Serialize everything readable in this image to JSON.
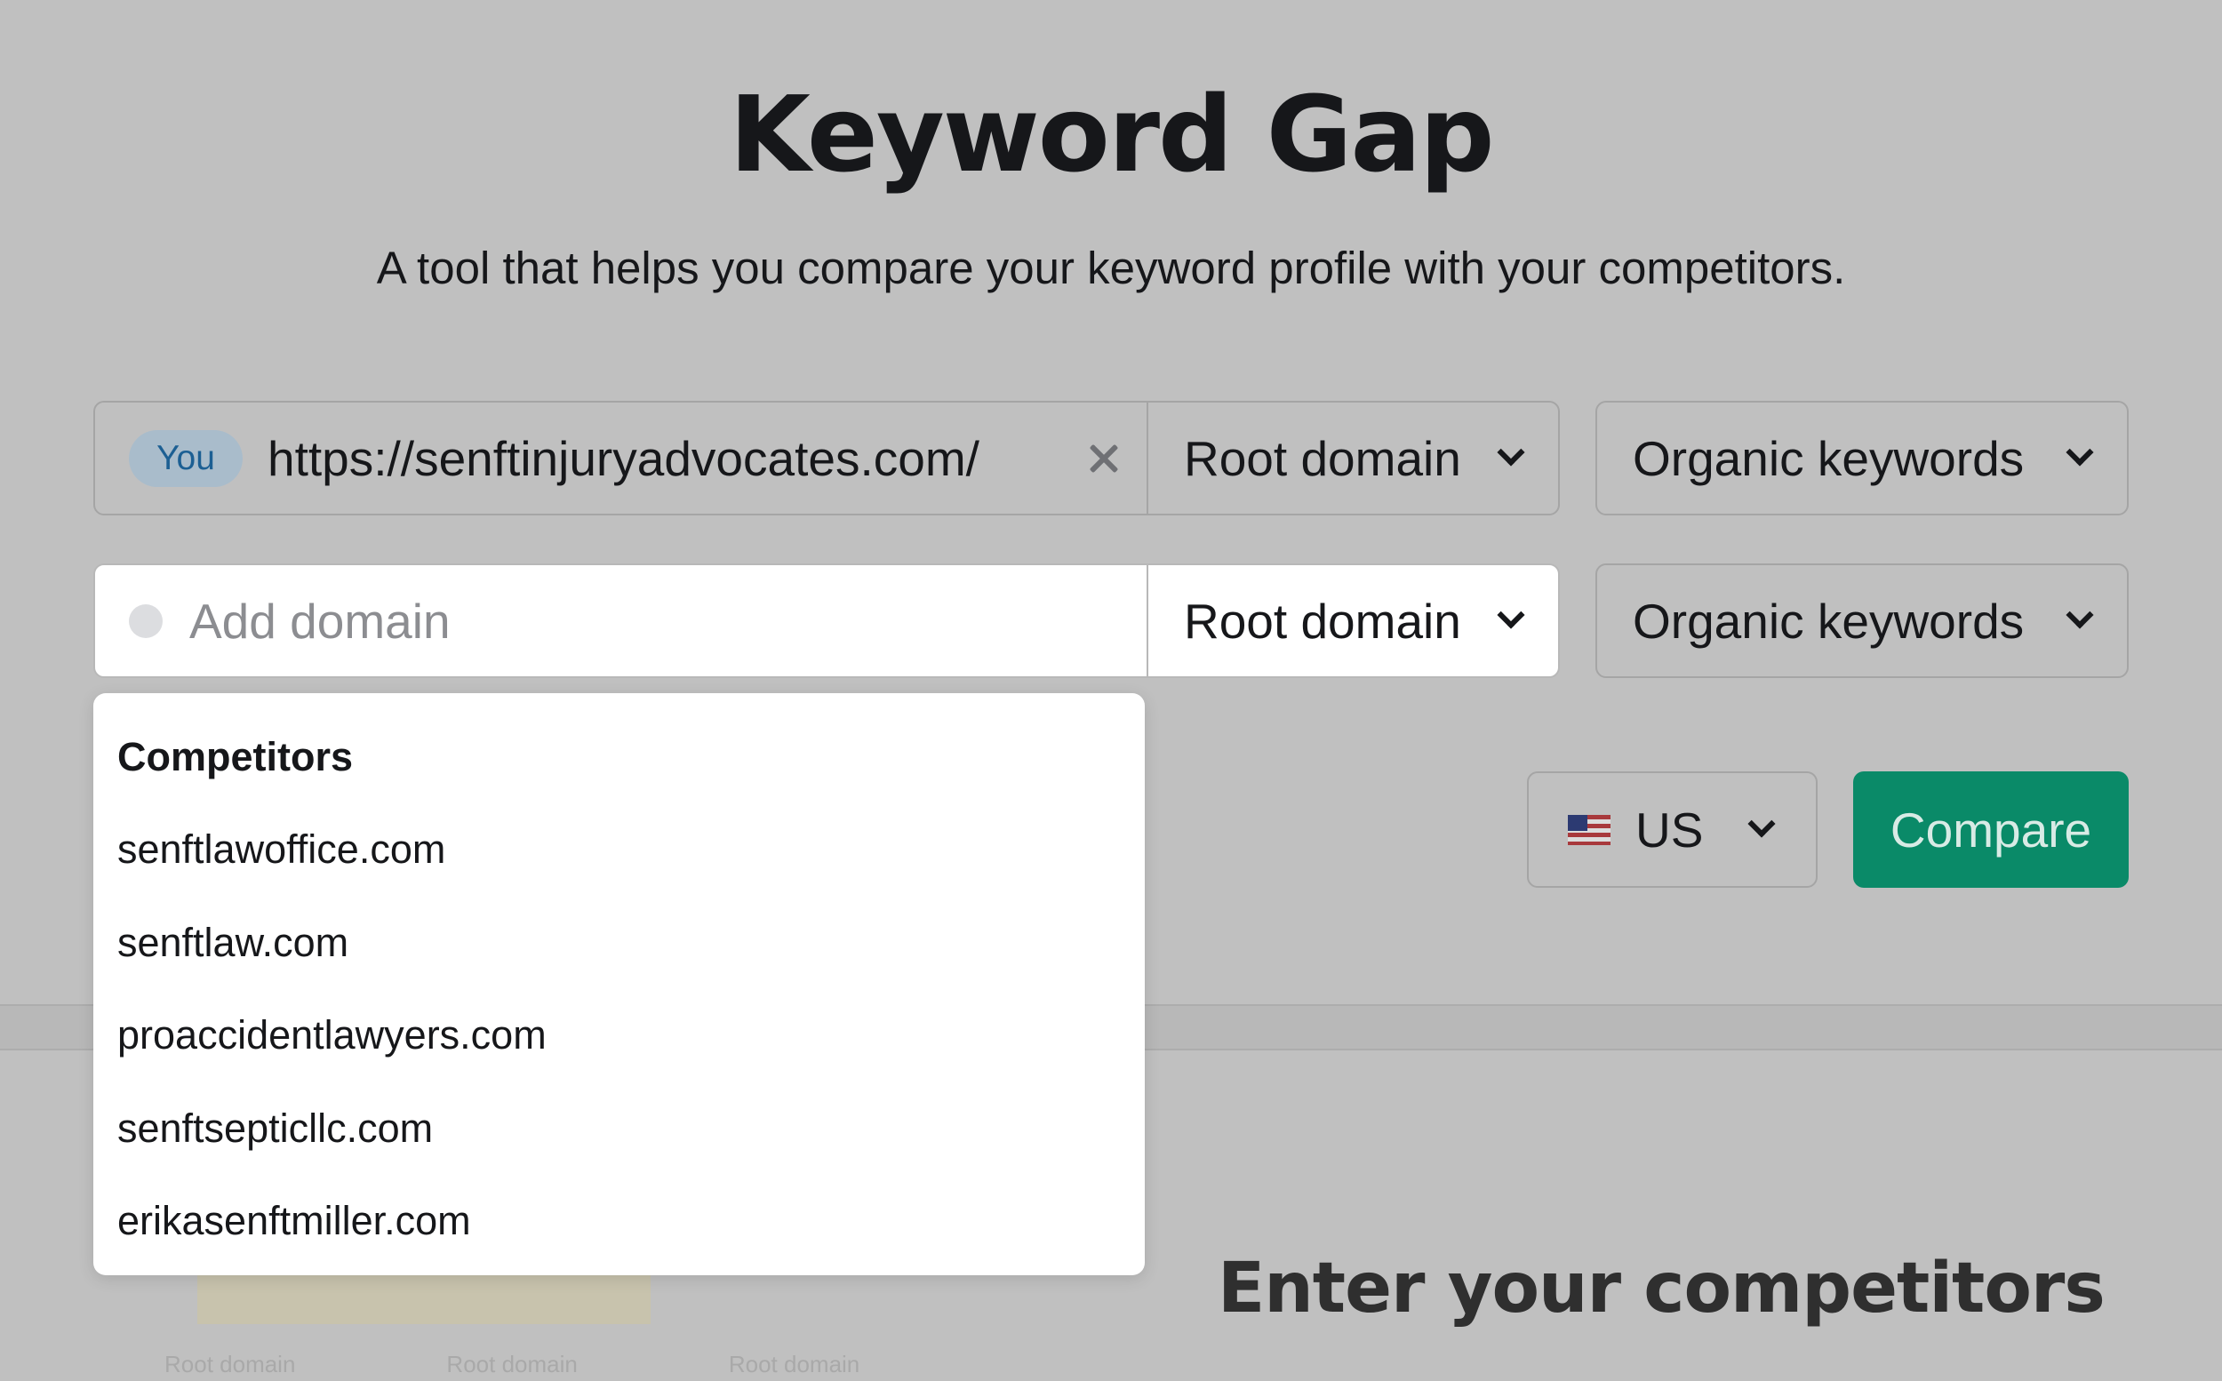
{
  "header": {
    "title": "Keyword Gap",
    "subtitle": "A tool that helps you compare your keyword profile with your competitors."
  },
  "rows": {
    "you": {
      "badge": "You",
      "domain": "https://senftinjuryadvocates.com/",
      "scope": "Root domain",
      "keyword_type": "Organic keywords"
    },
    "add": {
      "placeholder": "Add domain",
      "scope": "Root domain",
      "keyword_type": "Organic keywords"
    }
  },
  "database": {
    "selected": "US",
    "flag_icon": "us-flag-icon"
  },
  "compare_button": "Compare",
  "competitors": {
    "heading": "Competitors",
    "items": [
      "senftlawoffice.com",
      "senftlaw.com",
      "proaccidentlawyers.com",
      "senftsepticllc.com",
      "erikasenftmiller.com"
    ]
  },
  "lower_section": {
    "heading": "Enter your competitors",
    "faded_labels": [
      "Root domain",
      "Root domain",
      "Root domain"
    ]
  },
  "colors": {
    "background": "#c0c0c0",
    "compare_button": "#0a8a68",
    "you_badge": "#a9bccb",
    "you_badge_text": "#1c5f93"
  }
}
